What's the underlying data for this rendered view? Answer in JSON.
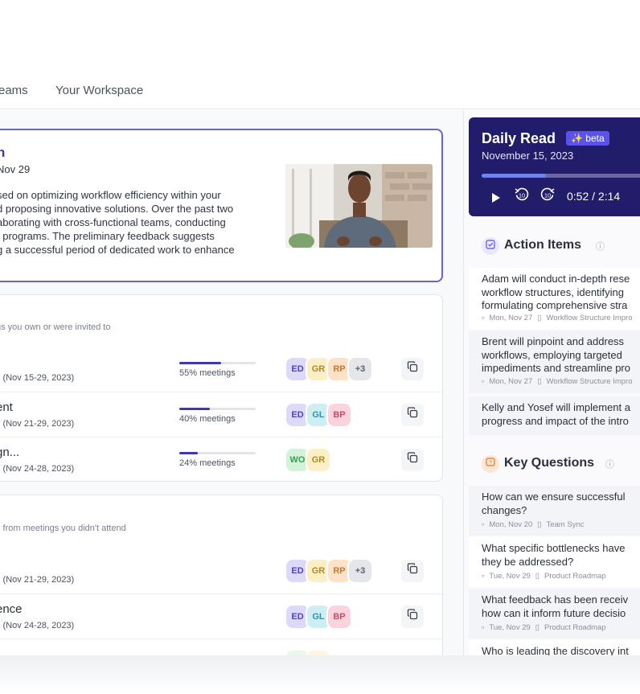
{
  "tabs": [
    {
      "label": "eams"
    },
    {
      "label": "Your Workspace"
    }
  ],
  "summary": {
    "title": "n",
    "date": "Nov 29",
    "lines": [
      "sed on optimizing workflow efficiency within your",
      "d proposing innovative solutions. Over the past two",
      "aborating with cross-functional teams, conducting",
      "t programs. The preliminary feedback suggests",
      "g a successful period of dedicated work to enhance"
    ]
  },
  "my_workstreams": {
    "subtitle": "gs you own or were invited to",
    "rows": [
      {
        "title": "",
        "date": "s (Nov 15-29, 2023)",
        "progress_label": "55% meetings",
        "progress": 0.55,
        "avatars": [
          "ED",
          "GR",
          "RP",
          "+3"
        ]
      },
      {
        "title": "ent",
        "date": "s (Nov 21-29, 2023)",
        "progress_label": "40% meetings",
        "progress": 0.4,
        "avatars": [
          "ED",
          "GL",
          "BP"
        ]
      },
      {
        "title": "gn...",
        "date": "s (Nov 24-28, 2023)",
        "progress_label": "24% meetings",
        "progress": 0.24,
        "avatars": [
          "WO",
          "GR"
        ]
      }
    ]
  },
  "missed": {
    "subtitle": "s from meetings you didn't attend",
    "rows": [
      {
        "title": "",
        "date": "s (Nov 21-29, 2023)",
        "avatars": [
          "ED",
          "GR",
          "RP",
          "+3"
        ]
      },
      {
        "title": "ence",
        "date": "s (Nov 24-28, 2023)",
        "avatars": [
          "ED",
          "GL",
          "BP"
        ]
      }
    ]
  },
  "avatar_colors": {
    "ED": {
      "bg": "#dcd9fb",
      "fg": "#4c44c4"
    },
    "GR": {
      "bg": "#fbefc6",
      "fg": "#b48a1f"
    },
    "RP": {
      "bg": "#fde2c7",
      "fg": "#c7772b"
    },
    "+3": {
      "bg": "#e5e6ea",
      "fg": "#5b606c"
    },
    "GL": {
      "bg": "#cdeff4",
      "fg": "#2e93a3"
    },
    "BP": {
      "bg": "#fbd3dc",
      "fg": "#c94a6a"
    },
    "WO": {
      "bg": "#d3f3d9",
      "fg": "#3e9a54"
    }
  },
  "daily_read": {
    "title": "Daily Read",
    "beta": "beta",
    "date": "November 15, 2023",
    "time": "0:52 / 2:14",
    "progress": 0.39
  },
  "action_items": {
    "title": "Action Items",
    "items": [
      {
        "lines": [
          "Adam will conduct in-depth rese",
          "workflow structures, identifying",
          "formulating comprehensive stra"
        ],
        "date": "Mon, Nov 27",
        "topic": "Workflow Structure Impro"
      },
      {
        "lines": [
          "Brent will pinpoint and address",
          "workflows, employing targeted",
          "impediments and streamline pro"
        ],
        "date": "Mon, Nov 27",
        "topic": "Workflow Structure Impro"
      },
      {
        "lines": [
          "Kelly and Yosef will implement a",
          "progress and impact of the intro"
        ],
        "date": "",
        "topic": ""
      }
    ]
  },
  "key_questions": {
    "title": "Key Questions",
    "items": [
      {
        "lines": [
          "How can we ensure successful",
          "changes?"
        ],
        "date": "Mon, Nov 20",
        "topic": "Team Sync"
      },
      {
        "lines": [
          "What specific bottlenecks have",
          "they be addressed?"
        ],
        "date": "Tue, Nov 29",
        "topic": "Product Roadmap"
      },
      {
        "lines": [
          "What feedback has been receiv",
          "how can it inform future decisio"
        ],
        "date": "Tue, Nov 29",
        "topic": "Product Roadmap"
      },
      {
        "lines": [
          "Who is leading the discovery int"
        ],
        "date": "",
        "topic": ""
      }
    ]
  }
}
